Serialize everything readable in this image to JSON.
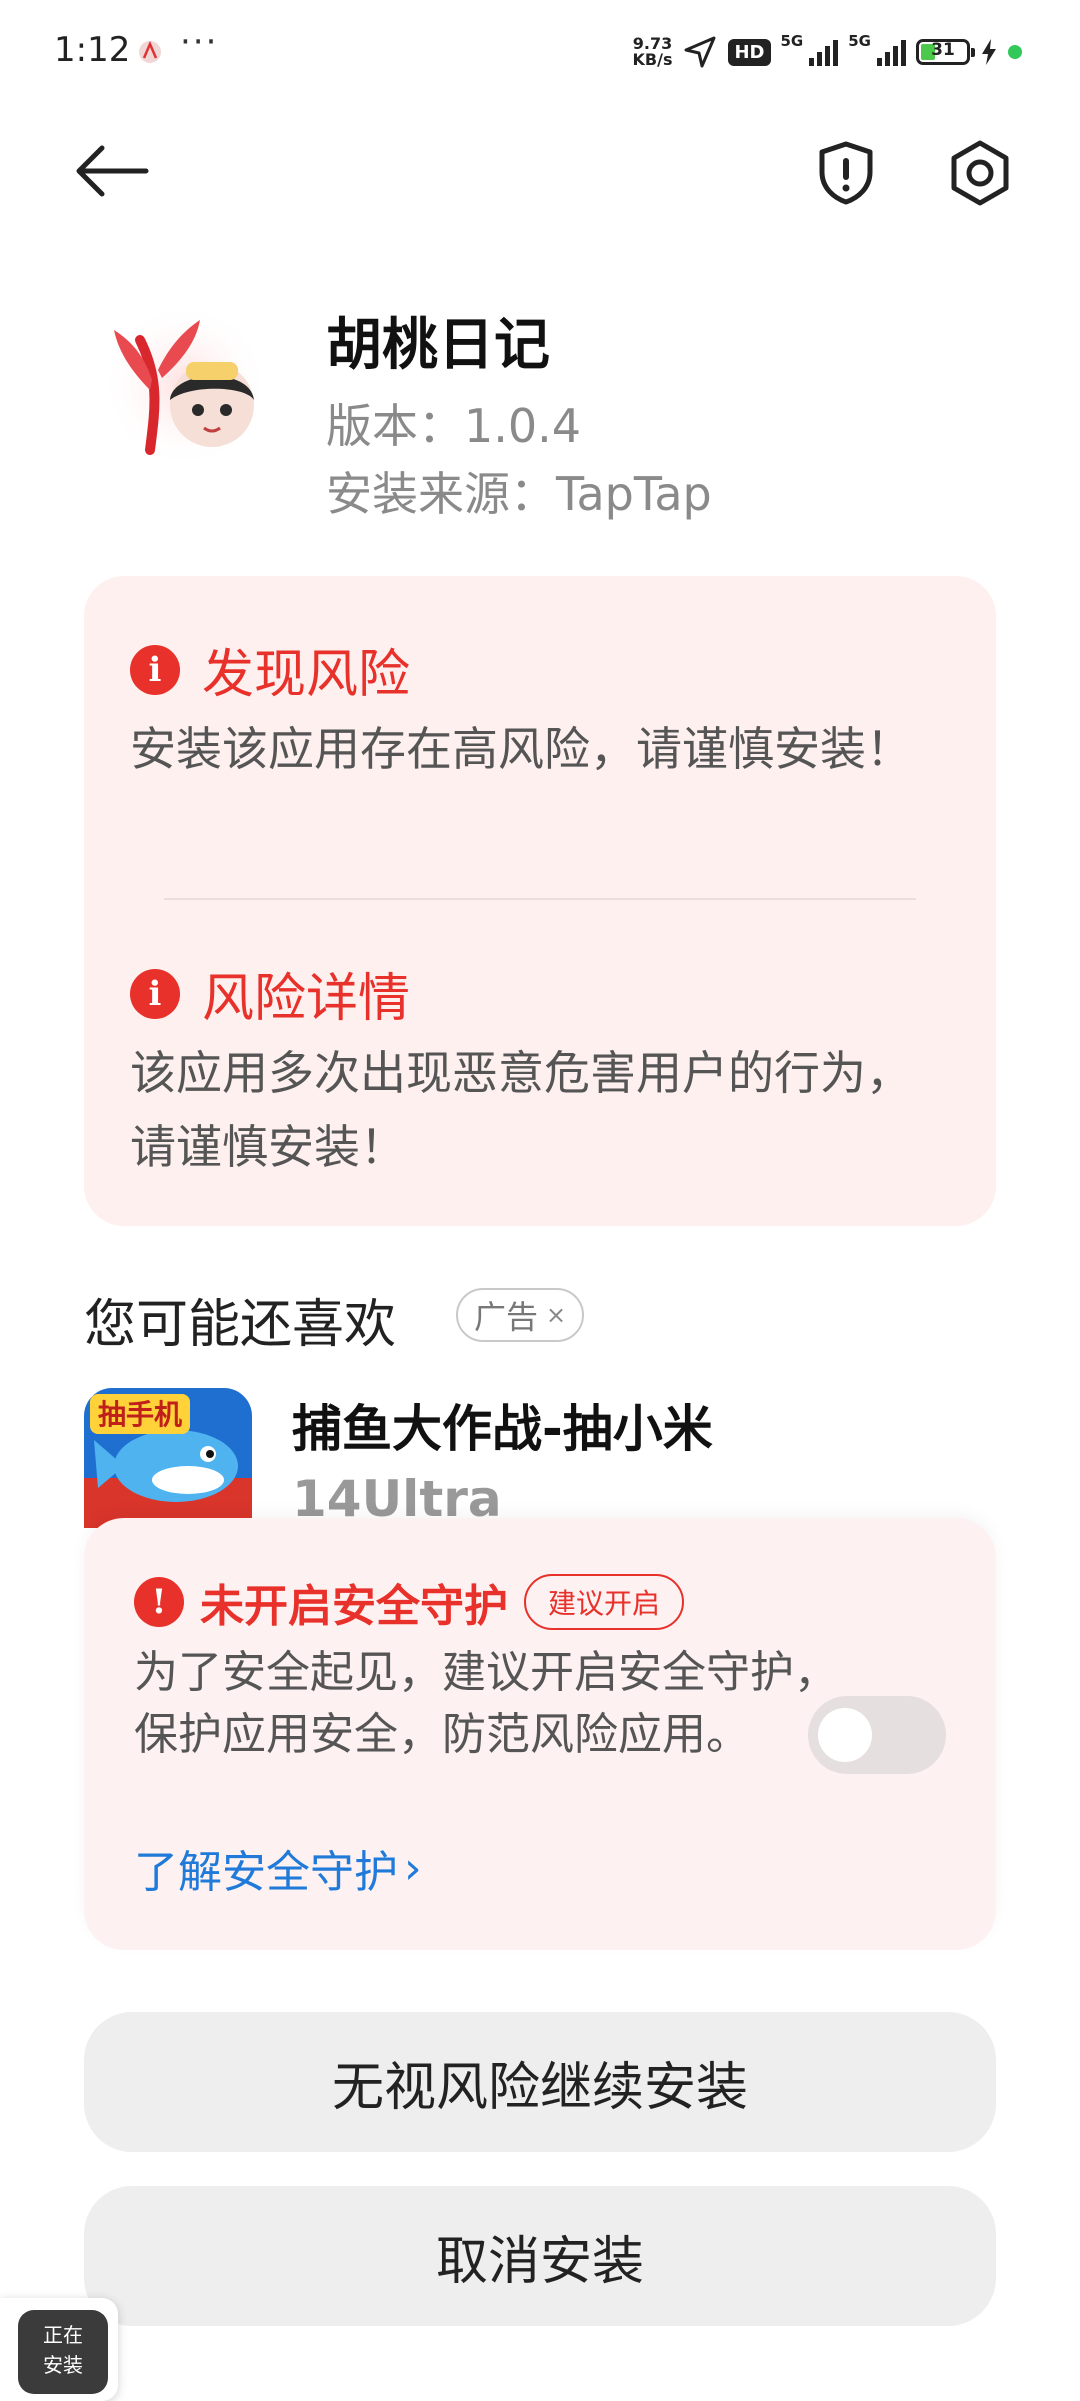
{
  "status_bar": {
    "time": "1:12",
    "more": "···",
    "speed_value": "9.73",
    "speed_unit": "KB/s",
    "hd": "HD",
    "net1": "5G",
    "net2": "5G",
    "battery": "31"
  },
  "app": {
    "name": "胡桃日记",
    "version": "版本：1.0.4",
    "source": "安装来源：TapTap"
  },
  "risk": {
    "found_title": "发现风险",
    "found_text": "安装该应用存在高风险，请谨慎安装！",
    "detail_title": "风险详情",
    "detail_text": "该应用多次出现恶意危害用户的行为，请谨慎安装！"
  },
  "recommend": {
    "title": "您可能还喜欢",
    "ad_label": "广告",
    "ad_close": "×",
    "app_name": "捕鱼大作战-抽小米",
    "app_name_cont": "14Ultra",
    "icon_text": "抽手机"
  },
  "protection": {
    "title": "未开启安全守护",
    "badge": "建议开启",
    "text": "为了安全起见，建议开启安全守护，保护应用安全，防范风险应用。",
    "link": "了解安全守护",
    "link_arrow": "›",
    "enabled": false
  },
  "actions": {
    "continue": "无视风险继续安装",
    "cancel": "取消安装"
  },
  "install_bubble": {
    "line1": "正在",
    "line2": "安装"
  },
  "colors": {
    "danger": "#e8312a",
    "link": "#1f7ad9",
    "card_bg": "#fdf0ee"
  }
}
